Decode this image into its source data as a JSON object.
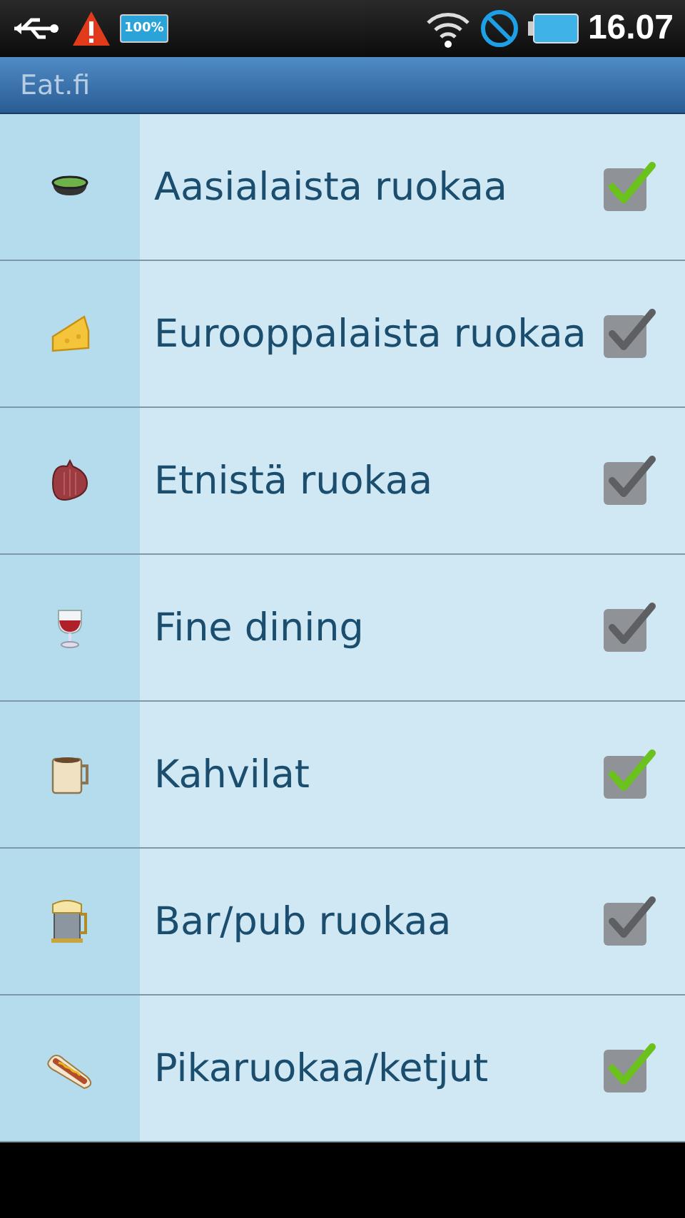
{
  "status_bar": {
    "battery_badge": "100%",
    "time": "16.07"
  },
  "app_bar": {
    "title": "Eat.fi"
  },
  "categories": [
    {
      "label": "Aasialaista ruokaa",
      "checked": true
    },
    {
      "label": "Eurooppalaista ruokaa",
      "checked": false
    },
    {
      "label": "Etnistä ruokaa",
      "checked": false
    },
    {
      "label": "Fine dining",
      "checked": false
    },
    {
      "label": "Kahvilat",
      "checked": true
    },
    {
      "label": "Bar/pub ruokaa",
      "checked": false
    },
    {
      "label": "Pikaruokaa/ketjut",
      "checked": true
    }
  ]
}
